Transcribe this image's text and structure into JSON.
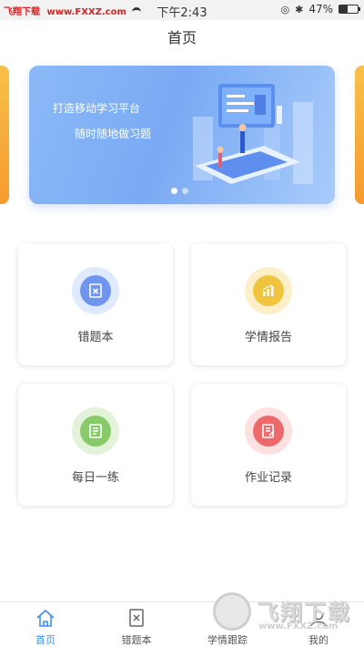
{
  "status_bar": {
    "brand": "飞翔下载",
    "url": "www.FXXZ.com",
    "time": "下午2:43",
    "battery_percent": "47%",
    "battery_level": 0.47
  },
  "header": {
    "title": "首页"
  },
  "banner": {
    "line1": "打造移动学习平台",
    "line2": "随时随地做习题",
    "slide_count": 2,
    "active_slide": 1
  },
  "cards": [
    {
      "label": "错题本",
      "icon": "error-book-icon",
      "color": "#6f95ee"
    },
    {
      "label": "学情报告",
      "icon": "report-chart-icon",
      "color": "#f1c43f"
    },
    {
      "label": "每日一练",
      "icon": "daily-practice-icon",
      "color": "#88c96a"
    },
    {
      "label": "作业记录",
      "icon": "homework-record-icon",
      "color": "#ee6a6a"
    }
  ],
  "tabs": [
    {
      "label": "首页",
      "icon": "home-icon",
      "active": true
    },
    {
      "label": "错题本",
      "icon": "error-book-icon",
      "active": false
    },
    {
      "label": "学情跟踪",
      "icon": "tracking-icon",
      "active": false
    },
    {
      "label": "我的",
      "icon": "profile-icon",
      "active": false
    }
  ],
  "watermark": {
    "text": "飞翔下载",
    "url": "www.FXXZ.com"
  },
  "colors": {
    "accent": "#3a8ff5",
    "banner_start": "#8bb9f6",
    "banner_end": "#a8cbfa"
  }
}
